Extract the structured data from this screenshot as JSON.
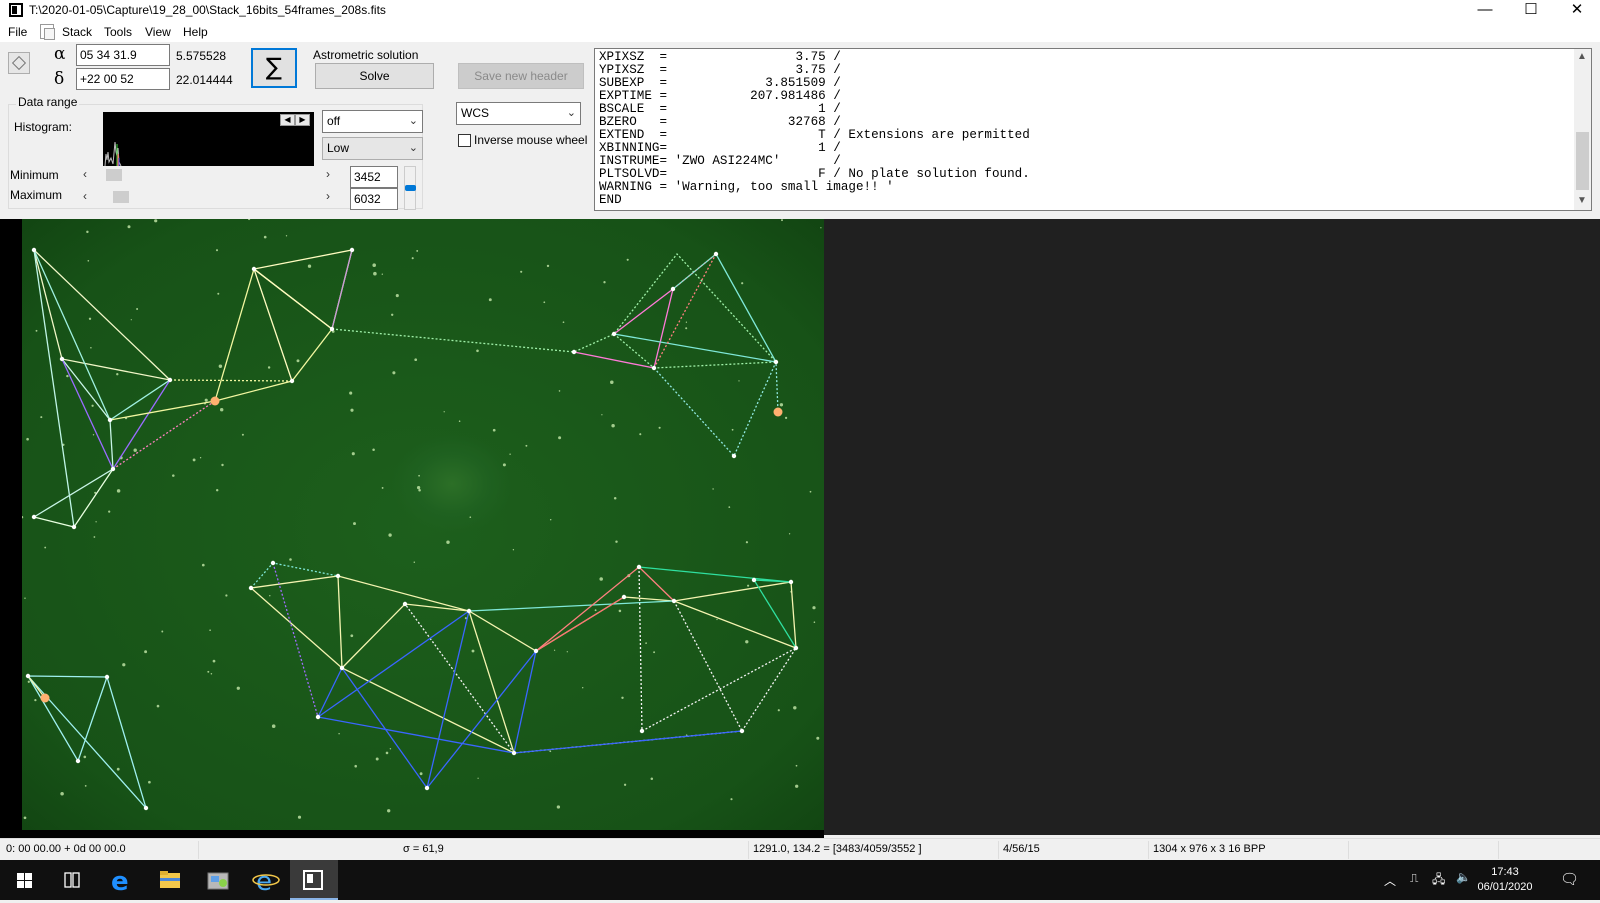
{
  "window": {
    "title": "T:\\2020-01-05\\Capture\\19_28_00\\Stack_16bits_54frames_208s.fits",
    "minimize_glyph": "—",
    "maximize_glyph": "☐",
    "close_glyph": "✕"
  },
  "menu": {
    "file": "File",
    "stack": "Stack",
    "tools": "Tools",
    "view": "View",
    "help": "Help"
  },
  "coords": {
    "alpha_symbol": "α",
    "delta_symbol": "δ",
    "ra_value": "05 34 31.9",
    "ra_decimal": "5.575528",
    "dec_value": "+22 00 52",
    "dec_decimal": "22.014444"
  },
  "sigma_glyph": "∑",
  "astrometric": {
    "title": "Astrometric solution",
    "solve_label": "Solve",
    "save_header_label": "Save new header"
  },
  "data_range": {
    "title": "Data range",
    "histogram_label": "Histogram:",
    "minimum_label": "Minimum",
    "maximum_label": "Maximum",
    "minimum_value": "3452",
    "maximum_value": "6032",
    "stretch_select": "off",
    "level_select": "Low",
    "projection_select": "WCS",
    "inverse_wheel_label": "Inverse mouse wheel",
    "inverse_wheel_checked": false,
    "minimum_slider_position": 0.03,
    "maximum_slider_position": 0.06
  },
  "fits_header_lines": [
    "XPIXSZ  =                 3.75 /",
    "YPIXSZ  =                 3.75 /",
    "SUBEXP  =             3.851509 /",
    "EXPTIME =           207.981486 /",
    "BSCALE  =                    1 /",
    "BZERO   =                32768 /",
    "EXTEND  =                    T / Extensions are permitted",
    "XBINNING=                    1 /",
    "INSTRUME= 'ZWO ASI224MC'       /",
    "PLTSOLVD=                    F / No plate solution found.",
    "WARNING = 'Warning, too small image!! '",
    "END"
  ],
  "status": {
    "coords_readout": "0: 00  00.00   + 0d 00  00.0",
    "sigma": "σ = 61,9",
    "pixel_readout": "1291.0, 134.2 = [3483/4059/3552 ]",
    "counts": "4/56/15",
    "image_info": "1304 x 976 x 3   16 BPP"
  },
  "taskbar": {
    "time": "17:43",
    "date": "06/01/2020"
  },
  "colors": {
    "sky": "#185418",
    "asterism_white": "#ffffff",
    "asterism_yellow": "#f4f4a0",
    "asterism_cyan": "#7fe8d8",
    "asterism_blue": "#3a66ff",
    "asterism_pink": "#ff6ad5",
    "asterism_purple": "#9a6cff",
    "selection_blue": "#0078d7"
  }
}
